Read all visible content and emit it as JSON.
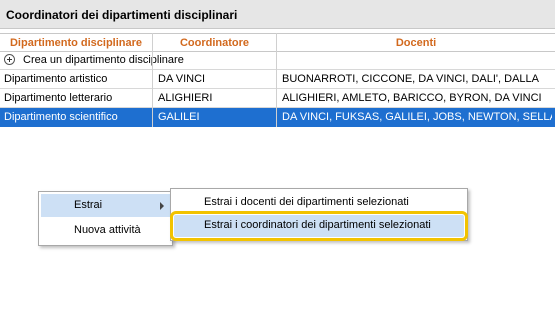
{
  "window": {
    "title": "Coordinatori dei dipartimenti disciplinari"
  },
  "table": {
    "headers": [
      "Dipartimento disciplinare",
      "Coordinatore",
      "Docenti"
    ],
    "create_label": "Crea un dipartimento disciplinare",
    "rows": [
      {
        "department": "Dipartimento artistico",
        "coordinator": "DA VINCI",
        "teachers": "BUONARROTI, CICCONE, DA VINCI, DALI', DALLA",
        "selected": false
      },
      {
        "department": "Dipartimento letterario",
        "coordinator": "ALIGHIERI",
        "teachers": "ALIGHIERI, AMLETO, BARICCO, BYRON, DA VINCI",
        "selected": false
      },
      {
        "department": "Dipartimento scientifico",
        "coordinator": "GALILEI",
        "teachers": "DA VINCI, FUKSAS, GALILEI, JOBS, NEWTON, SELLA",
        "selected": true
      }
    ]
  },
  "context_menu": {
    "items": [
      {
        "label": "Estrai",
        "has_submenu": true,
        "highlighted": true
      },
      {
        "label": "Nuova attività",
        "has_submenu": false,
        "highlighted": false
      }
    ]
  },
  "submenu": {
    "items": [
      {
        "label": "Estrai i docenti dei dipartimenti selezionati",
        "highlighted": false
      },
      {
        "label": "Estrai i coordinatori dei dipartimenti selezionati",
        "highlighted": true
      }
    ]
  },
  "colors": {
    "header_text": "#d2691e",
    "selection": "#1e6fd0",
    "hover": "#cde0f5",
    "focus_outline": "#f2c300"
  }
}
